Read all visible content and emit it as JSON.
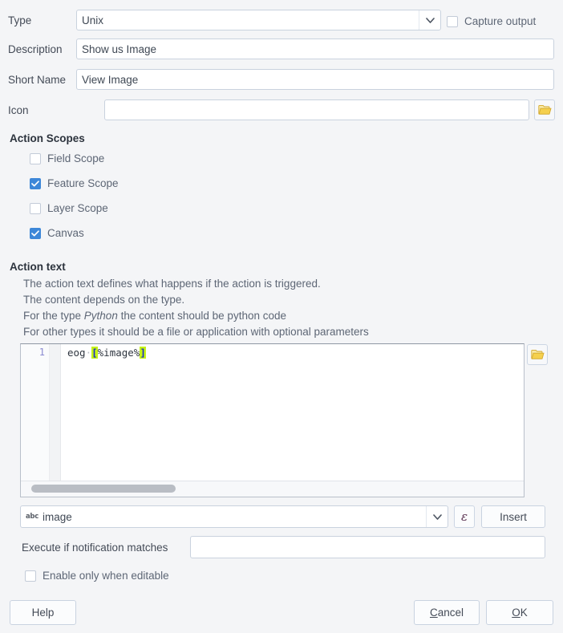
{
  "form": {
    "type": {
      "label": "Type",
      "value": "Unix",
      "arrow_icon": "chevron-down-icon"
    },
    "capture_output": {
      "label": "Capture output",
      "checked": false
    },
    "description": {
      "label": "Description",
      "value": "Show us Image"
    },
    "short_name": {
      "label": "Short Name",
      "value": "View Image"
    },
    "icon": {
      "label": "Icon",
      "value": "",
      "browse_icon": "folder-icon"
    }
  },
  "action_scopes": {
    "title": "Action Scopes",
    "items": [
      {
        "label": "Field Scope",
        "checked": false
      },
      {
        "label": "Feature Scope",
        "checked": true
      },
      {
        "label": "Layer Scope",
        "checked": false
      },
      {
        "label": "Canvas",
        "checked": true
      }
    ]
  },
  "action_text": {
    "title": "Action text",
    "help_lines": [
      "The action text defines what happens if the action is triggered.",
      "The content depends on the type."
    ],
    "help_python_prefix": "For the type ",
    "help_python_italic": "Python",
    "help_python_suffix": " the content should be python code",
    "help_other": "For other types it should be a file or application with optional parameters",
    "editor": {
      "line_number": "1",
      "code_prefix": "eog",
      "code_space_marker": "·",
      "code_open_bracket": "[",
      "code_variable": "%image%",
      "code_close_bracket": "]",
      "browse_icon": "folder-icon"
    }
  },
  "expression_row": {
    "field_icon_label": "abc",
    "field_icon_name": "abc-text-field-icon",
    "selected_field": "image",
    "arrow_icon": "chevron-down-icon",
    "expression_button_glyph": "ε",
    "insert_label": "Insert"
  },
  "notification": {
    "label": "Execute if notification matches",
    "value": ""
  },
  "enable_editable": {
    "label": "Enable only when editable",
    "checked": false
  },
  "buttons": {
    "help": "Help",
    "cancel_mnemonic": "C",
    "cancel_rest": "ancel",
    "ok_mnemonic": "O",
    "ok_rest": "K"
  },
  "colors": {
    "background": "#f4f5f7",
    "accent_checked": "#3d87d8",
    "highlight_bracket": "#c5f316",
    "bracket_text": "#1b2ccd",
    "field_border": "#c9d2de",
    "folder_yellow": "#f2cf4a",
    "epsilon": "#59304f"
  }
}
